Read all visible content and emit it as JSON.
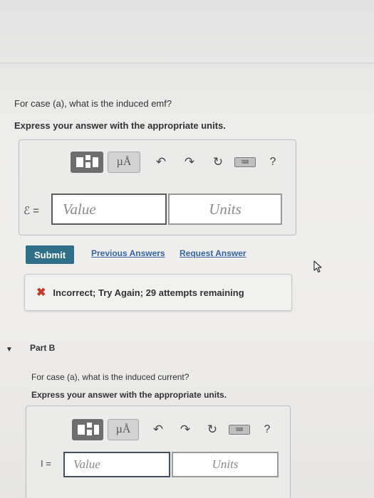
{
  "part_a": {
    "question": "For case (a), what is the induced emf?",
    "instruction": "Express your answer with the appropriate units.",
    "toolbar": {
      "templates_icon": "templates-icon",
      "units_label": "µÅ",
      "undo_icon": "undo-icon",
      "redo_icon": "redo-icon",
      "reset_icon": "reset-icon",
      "keyboard_icon": "keyboard-icon",
      "help_label": "?"
    },
    "symbol": "ℰ =",
    "value_placeholder": "Value",
    "units_placeholder": "Units",
    "submit_label": "Submit",
    "previous_answers_label": "Previous Answers",
    "request_answer_label": "Request Answer",
    "feedback": {
      "icon": "x-mark-icon",
      "status_color": "#c83a28",
      "message": "Incorrect; Try Again; 29 attempts remaining"
    }
  },
  "part_b": {
    "title": "Part B",
    "question": "For case (a), what is the induced current?",
    "instruction": "Express your answer with the appropriate units.",
    "toolbar": {
      "units_label": "µÅ",
      "help_label": "?"
    },
    "symbol": "I =",
    "value_placeholder": "Value",
    "units_placeholder": "Units"
  },
  "colors": {
    "submit": "#2f6f89",
    "link": "#3563a5"
  }
}
